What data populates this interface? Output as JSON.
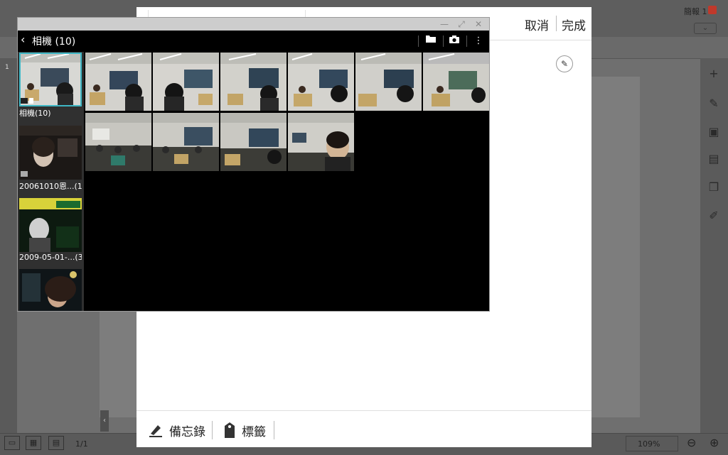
{
  "app": {
    "tab_label": "簡報 1",
    "page_tab": "1",
    "page_indicator": "1/1",
    "zoom": "109%"
  },
  "memo": {
    "cancel_label": "取消",
    "done_label": "完成",
    "memo_label": "備忘錄",
    "tag_label": "標籤"
  },
  "gallery": {
    "album_title": "相機 (10)",
    "albums": [
      {
        "label": "相機(10)"
      },
      {
        "label": "20061010恩...(1)"
      },
      {
        "label": "2009-05-01-...(3)"
      },
      {
        "label": ""
      }
    ],
    "photo_count": 10
  },
  "colors": {
    "selection": "#3fb7c5",
    "badge": "#c0392b"
  }
}
